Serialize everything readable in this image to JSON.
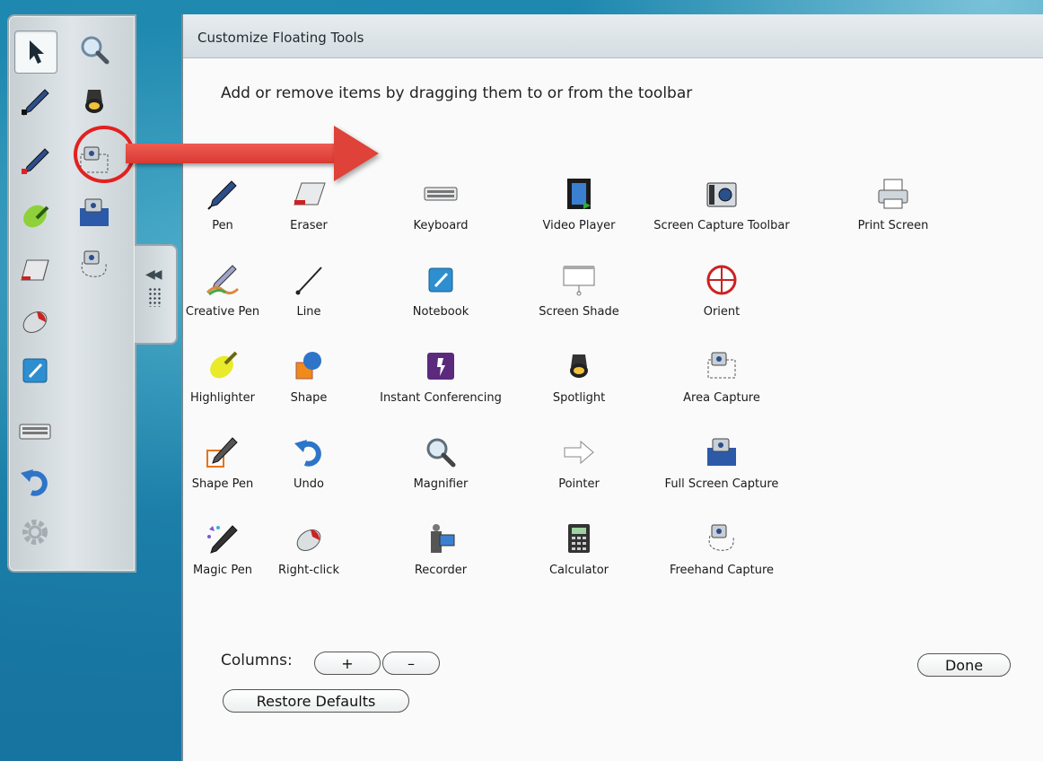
{
  "dialog": {
    "title": "Customize Floating Tools",
    "instructions": "Add or remove items by dragging them to or from the toolbar",
    "columns_label": "Columns:",
    "plus_label": "+",
    "minus_label": "–",
    "done_label": "Done",
    "restore_label": "Restore Defaults"
  },
  "tools": [
    {
      "label": "Pen",
      "icon": "pen-icon"
    },
    {
      "label": "Eraser",
      "icon": "eraser-icon"
    },
    {
      "label": "Keyboard",
      "icon": "keyboard-icon"
    },
    {
      "label": "Video Player",
      "icon": "video-player-icon"
    },
    {
      "label": "Screen Capture Toolbar",
      "icon": "camera-icon"
    },
    {
      "label": "Print Screen",
      "icon": "printer-icon"
    },
    {
      "label": "Creative Pen",
      "icon": "creative-pen-icon"
    },
    {
      "label": "Line",
      "icon": "line-icon"
    },
    {
      "label": "Notebook",
      "icon": "notebook-icon"
    },
    {
      "label": "Screen Shade",
      "icon": "screen-shade-icon"
    },
    {
      "label": "Orient",
      "icon": "orient-icon"
    },
    {
      "label": "Highlighter",
      "icon": "highlighter-icon"
    },
    {
      "label": "Shape",
      "icon": "shape-icon"
    },
    {
      "label": "Instant Conferencing",
      "icon": "conferencing-icon"
    },
    {
      "label": "Spotlight",
      "icon": "spotlight-icon"
    },
    {
      "label": "Area Capture",
      "icon": "area-capture-icon"
    },
    {
      "label": "Shape Pen",
      "icon": "shape-pen-icon"
    },
    {
      "label": "Undo",
      "icon": "undo-icon"
    },
    {
      "label": "Magnifier",
      "icon": "magnifier-icon"
    },
    {
      "label": "Pointer",
      "icon": "pointer-arrow-icon"
    },
    {
      "label": "Full Screen Capture",
      "icon": "full-screen-capture-icon"
    },
    {
      "label": "Magic Pen",
      "icon": "magic-pen-icon"
    },
    {
      "label": "Right-click",
      "icon": "right-click-icon"
    },
    {
      "label": "Recorder",
      "icon": "recorder-icon"
    },
    {
      "label": "Calculator",
      "icon": "calculator-icon"
    },
    {
      "label": "Freehand Capture",
      "icon": "freehand-capture-icon"
    }
  ],
  "toolbar": {
    "items": [
      "select-arrow-icon",
      "magnifier-icon",
      "pen-icon",
      "spotlight-icon",
      "pen-icon",
      "area-capture-icon",
      "highlighter-icon",
      "full-screen-capture-icon",
      "eraser-icon",
      "freehand-capture-icon",
      "right-click-icon",
      "notebook-icon",
      "keyboard-icon",
      "undo-icon",
      "settings-gear-icon"
    ]
  },
  "colors": {
    "accent_red": "#e3211f",
    "desktop_blue": "#1a7fa6"
  }
}
